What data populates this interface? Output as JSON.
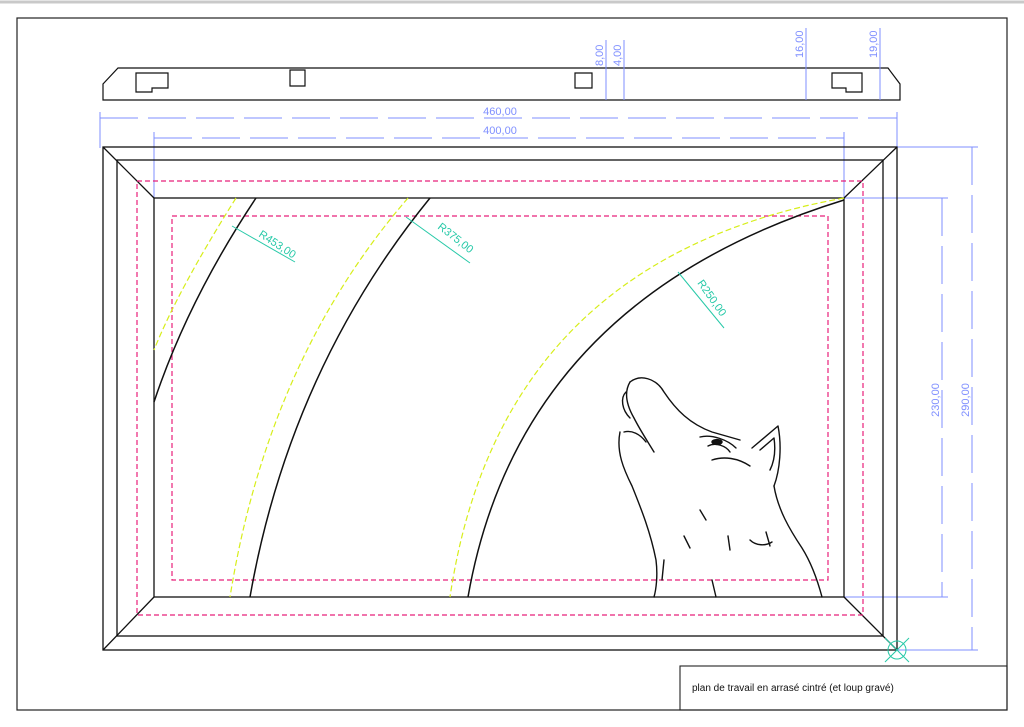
{
  "drawing": {
    "title_block_text": "plan de travail en arrasé cintré (et loup gravé)",
    "dimensions": {
      "overall_width": "460,00",
      "inner_width": "400,00",
      "overall_height": "290,00",
      "inner_height": "230,00",
      "top_offset_a": "8,00",
      "top_offset_b": "4,00",
      "top_offset_c": "16,00",
      "top_offset_d": "19,00"
    },
    "radii": {
      "arc_1": "R453,00",
      "arc_2": "R375,00",
      "arc_3": "R250,00"
    },
    "colors": {
      "outline": "#111111",
      "dimension": "#7f8fff",
      "radius_label": "#27c9a8",
      "offset_dashed": "#e8207a",
      "arc_dashed": "#d7ee1a"
    },
    "engraving_icon": "wolf-head"
  }
}
